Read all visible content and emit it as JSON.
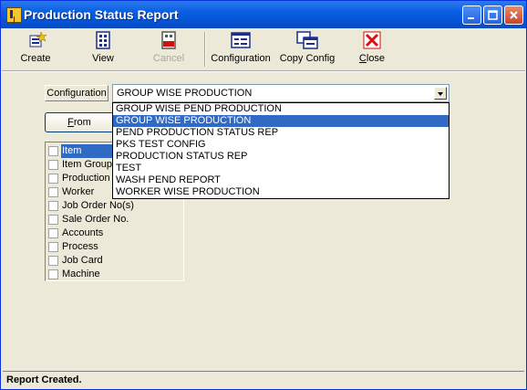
{
  "window": {
    "title": "Production Status Report"
  },
  "toolbar": {
    "create": "Create",
    "view": "View",
    "cancel": "Cancel",
    "configuration": "Configuration",
    "copy_config": "Copy Config",
    "close": "Close"
  },
  "config": {
    "label": "Configuration",
    "selected": "GROUP WISE PRODUCTION",
    "options": [
      "GROUP WISE PEND PRODUCTION",
      "GROUP WISE PRODUCTION",
      "PEND PRODUCTION STATUS REP",
      "PKS TEST CONFIG",
      "PRODUCTION STATUS REP",
      "TEST",
      "WASH PEND REPORT",
      "WORKER WISE PRODUCTION"
    ]
  },
  "from_button": "From",
  "list": {
    "items": [
      "Item",
      "Item Group",
      "Production L",
      "Worker",
      "Job Order No(s)",
      "Sale Order No.",
      "Accounts",
      "Process",
      "Job Card",
      "Machine"
    ]
  },
  "status": {
    "text": "Report Created."
  }
}
